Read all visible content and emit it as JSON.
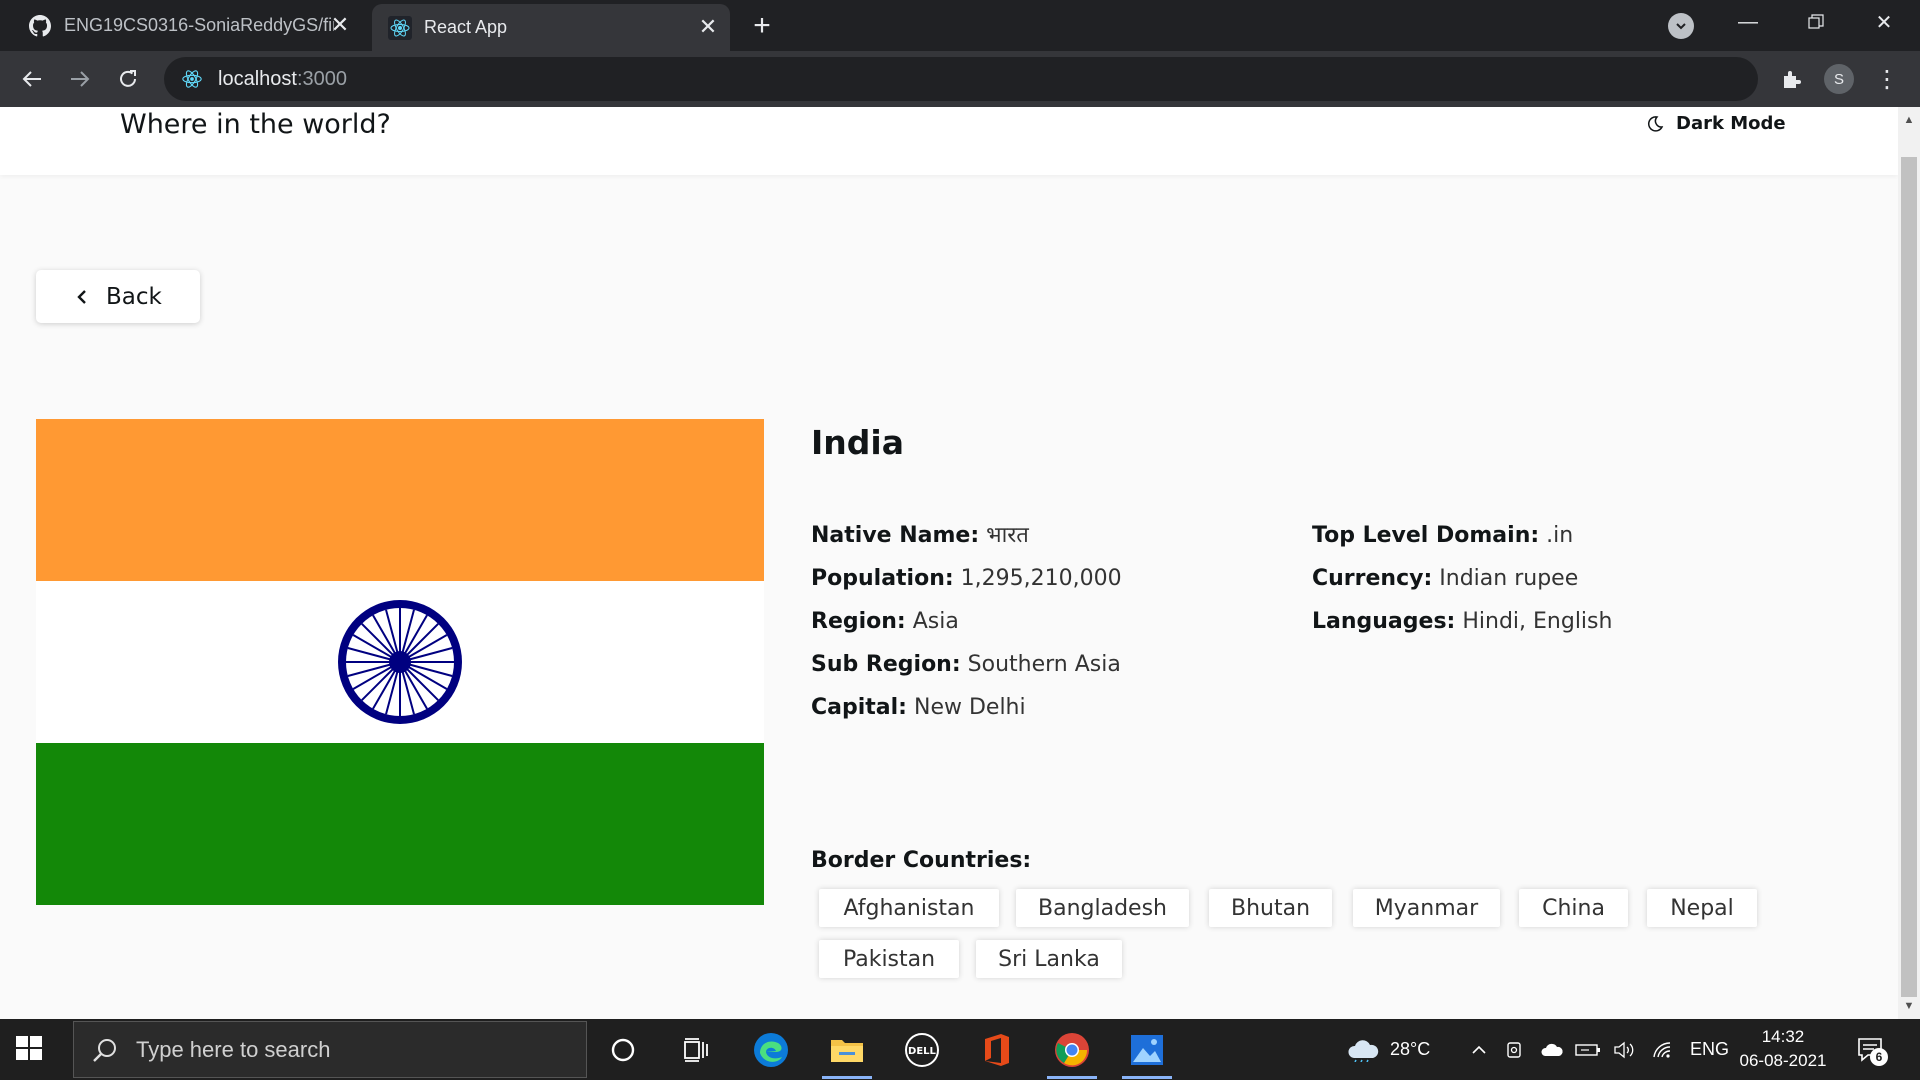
{
  "browser": {
    "tabs": [
      {
        "title": "ENG19CS0316-SoniaReddyGS/fin",
        "icon": "github-icon",
        "active": false
      },
      {
        "title": "React App",
        "icon": "react-icon",
        "active": true
      }
    ],
    "url_host": "localhost",
    "url_port": ":3000",
    "profile_initial": "S"
  },
  "app": {
    "title": "Where in the world?",
    "dark_mode_label": "Dark Mode",
    "back_label": "Back"
  },
  "country": {
    "name": "India",
    "flag_colors": {
      "saffron": "#FF9933",
      "white": "#FFFFFF",
      "green": "#138808",
      "chakra": "#000080"
    },
    "left_fields": [
      {
        "label": "Native Name:",
        "value": "भारत"
      },
      {
        "label": "Population:",
        "value": "1,295,210,000"
      },
      {
        "label": "Region:",
        "value": "Asia"
      },
      {
        "label": "Sub Region:",
        "value": "Southern Asia"
      },
      {
        "label": "Capital:",
        "value": "New Delhi"
      }
    ],
    "right_fields": [
      {
        "label": "Top Level Domain:",
        "value": ".in"
      },
      {
        "label": "Currency:",
        "value": "Indian rupee"
      },
      {
        "label": "Languages:",
        "value": "Hindi, English"
      }
    ],
    "border_label": "Border Countries:",
    "borders": [
      "Afghanistan",
      "Bangladesh",
      "Bhutan",
      "Myanmar",
      "China",
      "Nepal",
      "Pakistan",
      "Sri Lanka"
    ]
  },
  "taskbar": {
    "search_placeholder": "Type here to search",
    "temperature": "28°C",
    "language": "ENG",
    "time": "14:32",
    "date": "06-08-2021",
    "notification_count": "6"
  }
}
